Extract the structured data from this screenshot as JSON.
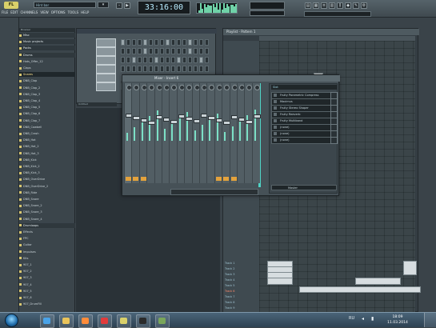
{
  "app": {
    "menu": [
      "FILE",
      "EDIT",
      "CHANNELS",
      "VIEW",
      "OPTIONS",
      "TOOLS",
      "HELP"
    ],
    "hint": "Hint bar",
    "time": "33:16:00",
    "tempo_label": "",
    "online_text": ""
  },
  "browser": {
    "title": "Browser",
    "items": [
      {
        "label": "Misc",
        "type": "folder"
      },
      {
        "label": "Music projects",
        "type": "folder"
      },
      {
        "label": "Packs",
        "type": "folder"
      },
      {
        "label": "Drums",
        "type": "folder"
      },
      {
        "label": "Hats_Offer_12",
        "type": "item"
      },
      {
        "label": "Claps",
        "type": "item"
      },
      {
        "label": "Snares",
        "type": "item"
      },
      {
        "label": "DNB_Clap",
        "type": "item"
      },
      {
        "label": "DNB_Clap_2",
        "type": "item"
      },
      {
        "label": "DNB_Clap_3",
        "type": "item"
      },
      {
        "label": "DNB_Clap_4",
        "type": "item"
      },
      {
        "label": "DNB_Clap_5",
        "type": "item"
      },
      {
        "label": "DNB_Clap_6",
        "type": "item"
      },
      {
        "label": "DNB_Clap_7",
        "type": "item"
      },
      {
        "label": "DNB_Cowbell",
        "type": "item"
      },
      {
        "label": "DNB_Crash",
        "type": "item"
      },
      {
        "label": "DNB_Hat",
        "type": "item"
      },
      {
        "label": "DNB_Hat_2",
        "type": "item"
      },
      {
        "label": "DNB_Hat_3",
        "type": "item"
      },
      {
        "label": "DNB_Kick",
        "type": "item"
      },
      {
        "label": "DNB_Kick_2",
        "type": "item"
      },
      {
        "label": "DNB_Kick_3",
        "type": "item"
      },
      {
        "label": "DNB_OverDrive",
        "type": "item"
      },
      {
        "label": "DNB_OverDrive_2",
        "type": "item"
      },
      {
        "label": "DNB_Ride",
        "type": "item"
      },
      {
        "label": "DNB_Snare",
        "type": "item"
      },
      {
        "label": "DNB_Snare_2",
        "type": "item"
      },
      {
        "label": "DNB_Snare_3",
        "type": "item"
      },
      {
        "label": "DNB_Snare_4",
        "type": "item"
      },
      {
        "label": "Drumloops",
        "type": "folder"
      },
      {
        "label": "Effects",
        "type": "item"
      },
      {
        "label": "FPC",
        "type": "item"
      },
      {
        "label": "Guitar",
        "type": "item"
      },
      {
        "label": "Impulses",
        "type": "item"
      },
      {
        "label": "Kits",
        "type": "item"
      },
      {
        "label": "907_1",
        "type": "item"
      },
      {
        "label": "907_2",
        "type": "item"
      },
      {
        "label": "907_3",
        "type": "item"
      },
      {
        "label": "907_4",
        "type": "item"
      },
      {
        "label": "907_5",
        "type": "item"
      },
      {
        "label": "907_6",
        "type": "item"
      },
      {
        "label": "907_DrumFill",
        "type": "item"
      }
    ]
  },
  "channel_rack": {
    "current_label": "Untitled",
    "rows": [
      {
        "steps": [
          1,
          0,
          0,
          0,
          1,
          0,
          0,
          0,
          1,
          0,
          0,
          0,
          1,
          0,
          0,
          0
        ]
      },
      {
        "steps": [
          0,
          0,
          0,
          0,
          1,
          0,
          0,
          0,
          0,
          0,
          0,
          0,
          1,
          0,
          0,
          0
        ]
      },
      {
        "steps": [
          0,
          0,
          1,
          0,
          0,
          0,
          1,
          0,
          0,
          0,
          1,
          0,
          0,
          0,
          1,
          0
        ]
      },
      {
        "steps": [
          0,
          0,
          0,
          0,
          0,
          0,
          0,
          0,
          0,
          0,
          0,
          0,
          0,
          0,
          0,
          0
        ]
      },
      {
        "steps": [
          0,
          0,
          0,
          0,
          0,
          0,
          0,
          0,
          0,
          0,
          0,
          0,
          0,
          0,
          0,
          0
        ]
      },
      {
        "steps": [
          0,
          0,
          0,
          0,
          0,
          0,
          0,
          0,
          0,
          0,
          0,
          0,
          0,
          0,
          0,
          0
        ]
      }
    ]
  },
  "playlist": {
    "title": "Playlist - Pattern 1",
    "tracks": [
      "Track 1",
      "Track 2",
      "Track 3",
      "Track 4",
      "Track 5",
      "Track 6",
      "Track 7",
      "Track 8",
      "Track 9",
      "Track 10"
    ],
    "highlight_track": "Track 6"
  },
  "mixer": {
    "title": "Mixer - Insert 6",
    "fx_header": "Slot",
    "fx_slots": [
      "Fruity Parametric Compress",
      "Maximus",
      "Fruity Stereo Shaper",
      "Fruity Reeverb",
      "Fruity Multiband",
      "(none)",
      "(none)",
      "(none)"
    ],
    "output_label": "Master"
  },
  "taskbar": {
    "lang": "RU",
    "time": "18:09",
    "date": "11.03.2014",
    "apps": [
      {
        "name": "ie",
        "color": "#4aa3e8"
      },
      {
        "name": "explorer",
        "color": "#e9c35a"
      },
      {
        "name": "media",
        "color": "#ff8c3a"
      },
      {
        "name": "record",
        "color": "#e23b3b"
      },
      {
        "name": "fl",
        "color": "#d9d06a"
      },
      {
        "name": "screen",
        "color": "#2b2b2b"
      },
      {
        "name": "paint",
        "color": "#7aa65a"
      }
    ]
  }
}
